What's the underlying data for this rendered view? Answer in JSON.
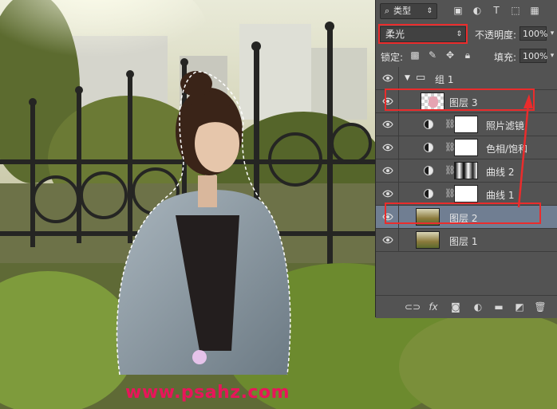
{
  "panel": {
    "filter_select": {
      "icon": "search-icon",
      "label": "类型"
    },
    "filter_icons": [
      "image-icon",
      "circle-half-icon",
      "text-icon",
      "transform-icon",
      "smart-object-icon"
    ],
    "blend_mode": "柔光",
    "opacity_label": "不透明度:",
    "opacity_value": "100%",
    "lock_label": "锁定:",
    "lock_icons": [
      "lock-transparent-icon",
      "brush-icon",
      "move-icon",
      "lock-icon"
    ],
    "fill_label": "填充:",
    "fill_value": "100%"
  },
  "layers": [
    {
      "name": "组 1",
      "kind": "group",
      "visible": true
    },
    {
      "name": "图层 3",
      "kind": "pixel",
      "visible": true,
      "highlighted": true
    },
    {
      "name": "照片滤镜",
      "kind": "adjustment",
      "visible": true
    },
    {
      "name": "色相/饱和",
      "kind": "adjustment",
      "visible": true
    },
    {
      "name": "曲线 2",
      "kind": "adjustment",
      "visible": true
    },
    {
      "name": "曲线 1",
      "kind": "adjustment",
      "visible": true
    },
    {
      "name": "图层 2",
      "kind": "pixel",
      "visible": true,
      "selected": true,
      "highlighted": true
    },
    {
      "name": "图层 1",
      "kind": "pixel",
      "visible": true
    }
  ],
  "bottom_icons": [
    "link-icon",
    "fx-icon",
    "mask-icon",
    "adjustment-icon",
    "folder-icon",
    "new-layer-icon",
    "trash-icon"
  ],
  "watermark": "www.psahz.com",
  "colors": {
    "accent_red": "#ea2c2c",
    "watermark": "#e8155a",
    "selection": "#707e92",
    "panel": "#535353"
  }
}
